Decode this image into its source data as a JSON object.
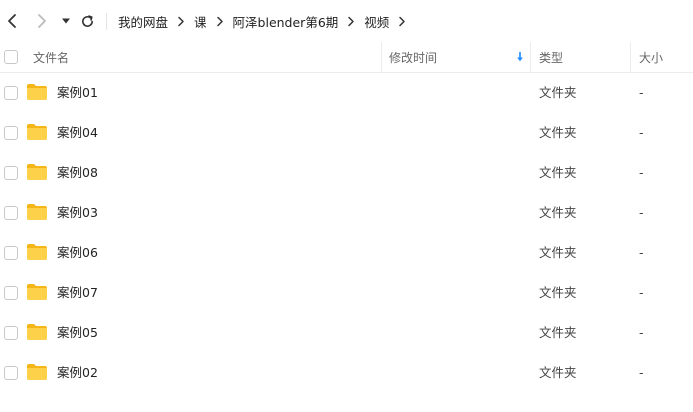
{
  "breadcrumb": [
    {
      "label": "我的网盘"
    },
    {
      "label": "课"
    },
    {
      "label": "阿泽blender第6期"
    },
    {
      "label": "视频"
    }
  ],
  "columns": {
    "name": "文件名",
    "modified": "修改时间",
    "type": "类型",
    "size": "大小"
  },
  "sort": {
    "column": "modified",
    "direction": "descending",
    "color": "#1a8cff"
  },
  "folder_color": "#f8c22b",
  "files": [
    {
      "name": "案例01",
      "modified": "",
      "type": "文件夹",
      "size": "-"
    },
    {
      "name": "案例04",
      "modified": "",
      "type": "文件夹",
      "size": "-"
    },
    {
      "name": "案例08",
      "modified": "",
      "type": "文件夹",
      "size": "-"
    },
    {
      "name": "案例03",
      "modified": "",
      "type": "文件夹",
      "size": "-"
    },
    {
      "name": "案例06",
      "modified": "",
      "type": "文件夹",
      "size": "-"
    },
    {
      "name": "案例07",
      "modified": "",
      "type": "文件夹",
      "size": "-"
    },
    {
      "name": "案例05",
      "modified": "",
      "type": "文件夹",
      "size": "-"
    },
    {
      "name": "案例02",
      "modified": "",
      "type": "文件夹",
      "size": "-"
    }
  ]
}
